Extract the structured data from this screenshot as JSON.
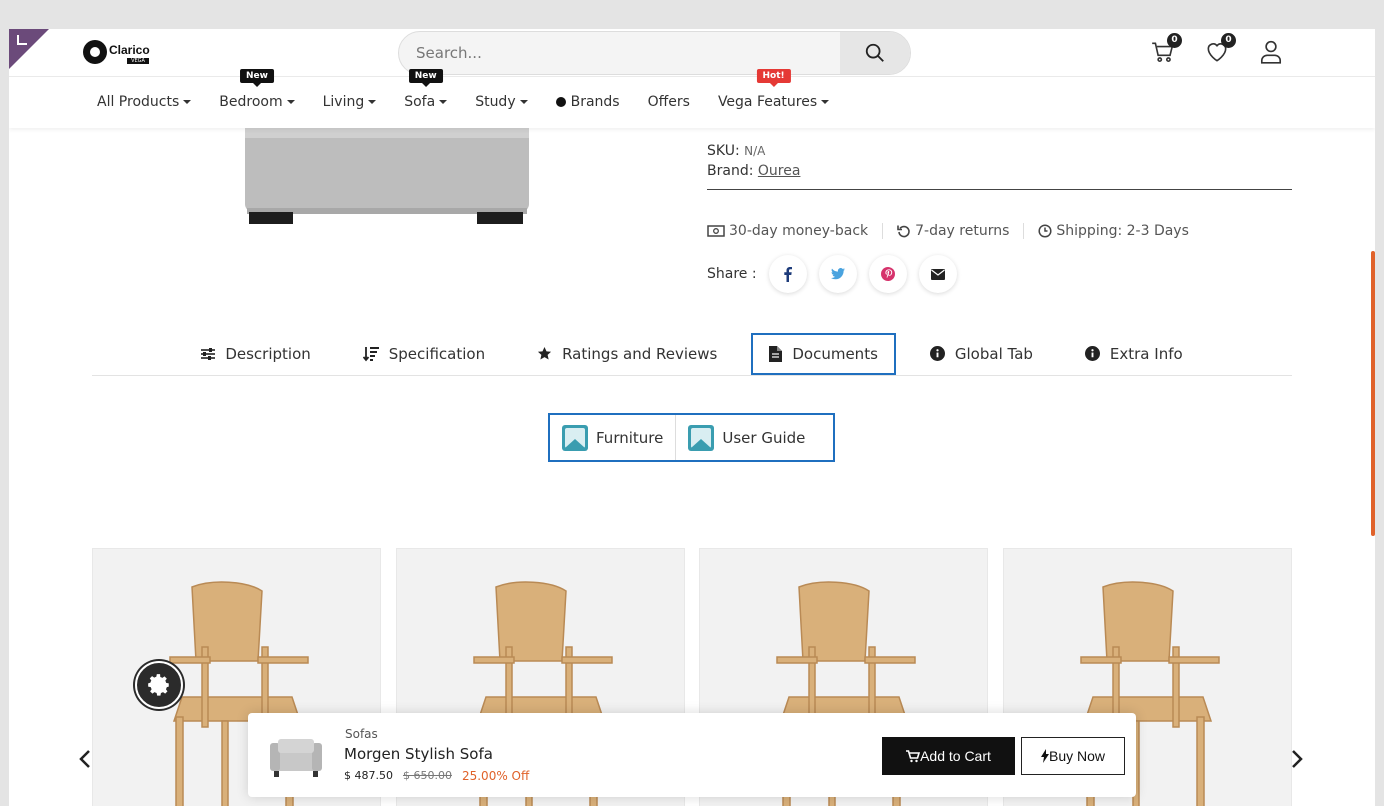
{
  "header": {
    "logo_text": "Clarico",
    "logo_sub": "VEGA",
    "search_placeholder": "Search...",
    "cart_count": "0",
    "wishlist_count": "0"
  },
  "nav": {
    "items": [
      {
        "label": "All Products",
        "tag": ""
      },
      {
        "label": "Bedroom",
        "tag": "New"
      },
      {
        "label": "Living",
        "tag": ""
      },
      {
        "label": "Sofa",
        "tag": "New"
      },
      {
        "label": "Study",
        "tag": ""
      },
      {
        "label": "Brands",
        "tag": ""
      },
      {
        "label": "Offers",
        "tag": ""
      },
      {
        "label": "Vega Features",
        "tag": "Hot!"
      }
    ]
  },
  "product": {
    "sku_label": "SKU:",
    "sku_value": "N/A",
    "brand_label": "Brand:",
    "brand_value": "Ourea",
    "features": [
      "30-day money-back",
      "7-day returns",
      "Shipping: 2-3 Days"
    ],
    "share_label": "Share :"
  },
  "tabs": [
    {
      "label": "Description"
    },
    {
      "label": "Specification"
    },
    {
      "label": "Ratings and Reviews"
    },
    {
      "label": "Documents"
    },
    {
      "label": "Global Tab"
    },
    {
      "label": "Extra Info"
    }
  ],
  "documents": [
    {
      "label": "Furniture"
    },
    {
      "label": "User Guide"
    }
  ],
  "sticky": {
    "category": "Sofas",
    "name": "Morgen Stylish Sofa",
    "price": "$ 487.50",
    "old_price": "$ 650.00",
    "discount": "25.00% Off",
    "add_to_cart": "Add to Cart",
    "buy_now": "Buy Now"
  },
  "colors": {
    "accent_blue": "#1f6fbf",
    "discount_orange": "#e0622a",
    "hot_red": "#e53935"
  }
}
